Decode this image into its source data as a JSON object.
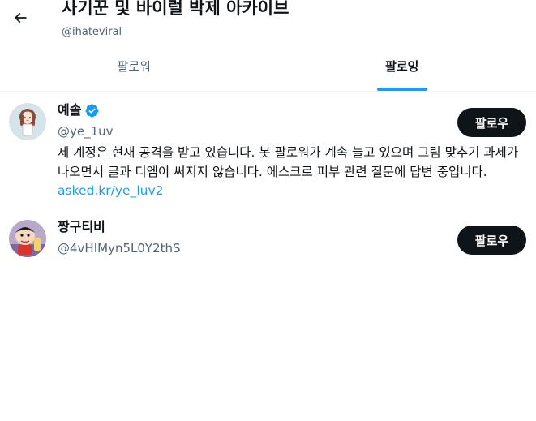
{
  "header": {
    "title": "사기꾼 및 바이럴 박제 아카이브",
    "handle": "@ihateviral",
    "back_icon": "arrow-left-icon"
  },
  "tabs": [
    {
      "label": "팔로워",
      "active": false
    },
    {
      "label": "팔로잉",
      "active": true
    }
  ],
  "accent_color": "#1d9bf0",
  "users": [
    {
      "name": "예솔",
      "verified": true,
      "handle": "@ye_1uv",
      "bio_text": "제 계정은 현재 공격을 받고 있습니다. 봇 팔로워가 계속 늘고 있으며 그림 맞추기 과제가 나오면서 글과 디엠이 써지지 않습니다. 에스크로 피부 관련 질문에 답변 중입니다. ",
      "bio_link": "asked.kr/ye_luv2",
      "follow_label": "팔로우"
    },
    {
      "name": "짱구티비",
      "verified": false,
      "handle": "@4vHIMyn5L0Y2thS",
      "follow_label": "팔로우"
    }
  ]
}
